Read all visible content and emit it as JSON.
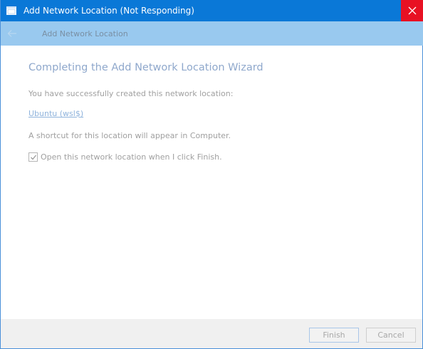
{
  "window": {
    "title": "Add Network Location (Not Responding)",
    "titlebar_color": "#0a78d7",
    "close_color": "#e81123"
  },
  "header": {
    "title": "Add Network Location",
    "band_color": "#99c9ef"
  },
  "content": {
    "heading": "Completing the Add Network Location Wizard",
    "success_text": "You have successfully created this network location:",
    "location_link": "Ubuntu (wsl$)",
    "shortcut_text": "A shortcut for this location will appear in Computer.",
    "open_checkbox": {
      "label": "Open this network location when I click Finish.",
      "checked": true
    }
  },
  "footer": {
    "finish_label": "Finish",
    "cancel_label": "Cancel"
  }
}
